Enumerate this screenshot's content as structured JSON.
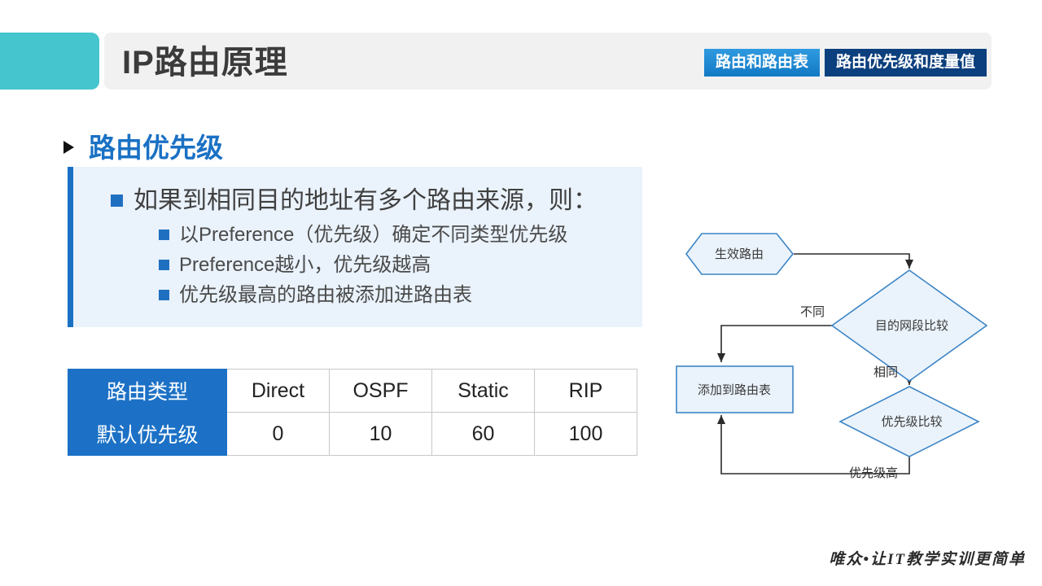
{
  "header": {
    "title": "IP路由原理",
    "accent_teal": "#45c5cd",
    "bar_bg": "#f1f1f1",
    "tabs": [
      {
        "label": "路由和路由表",
        "state": "inactive",
        "color": "#1279c4"
      },
      {
        "label": "路由优先级和度量值",
        "state": "active",
        "color": "#0b3f7d"
      }
    ]
  },
  "section": {
    "title": "路由优先级",
    "title_color": "#1a71c4",
    "bullet_icon": "triangle-right-icon"
  },
  "content": {
    "box_bg": "#eaf2fb",
    "accent_bar": "#1a71c4",
    "lead_bullet": "如果到相同目的地址有多个路由来源，则：",
    "sub_bullets": [
      "以Preference（优先级）确定不同类型优先级",
      "Preference越小，优先级越高",
      "优先级最高的路由被添加进路由表"
    ]
  },
  "table": {
    "header_bg": "#1c71c6",
    "rows": [
      {
        "head": "路由类型",
        "cells": [
          "Direct",
          "OSPF",
          "Static",
          "RIP"
        ]
      },
      {
        "head": "默认优先级",
        "cells": [
          "0",
          "10",
          "60",
          "100"
        ]
      }
    ]
  },
  "flowchart": {
    "node_fill": "#eaf3fb",
    "node_stroke": "#3d85c6",
    "edge_color": "#2b2b2b",
    "nodes": [
      {
        "id": "start",
        "shape": "hexagon",
        "label": "生效路由"
      },
      {
        "id": "decision1",
        "shape": "diamond",
        "label": "目的网段比较"
      },
      {
        "id": "decision2",
        "shape": "diamond",
        "label": "优先级比较"
      },
      {
        "id": "action",
        "shape": "rectangle",
        "label": "添加到路由表"
      }
    ],
    "edge_labels": [
      {
        "from": "decision1",
        "to": "action",
        "label": "不同"
      },
      {
        "from": "decision1",
        "to": "decision2",
        "label": "相同"
      },
      {
        "from": "decision2",
        "to": "action",
        "label": "优先级高"
      }
    ]
  },
  "footer": {
    "text": "唯众•让IT教学实训更简单"
  }
}
